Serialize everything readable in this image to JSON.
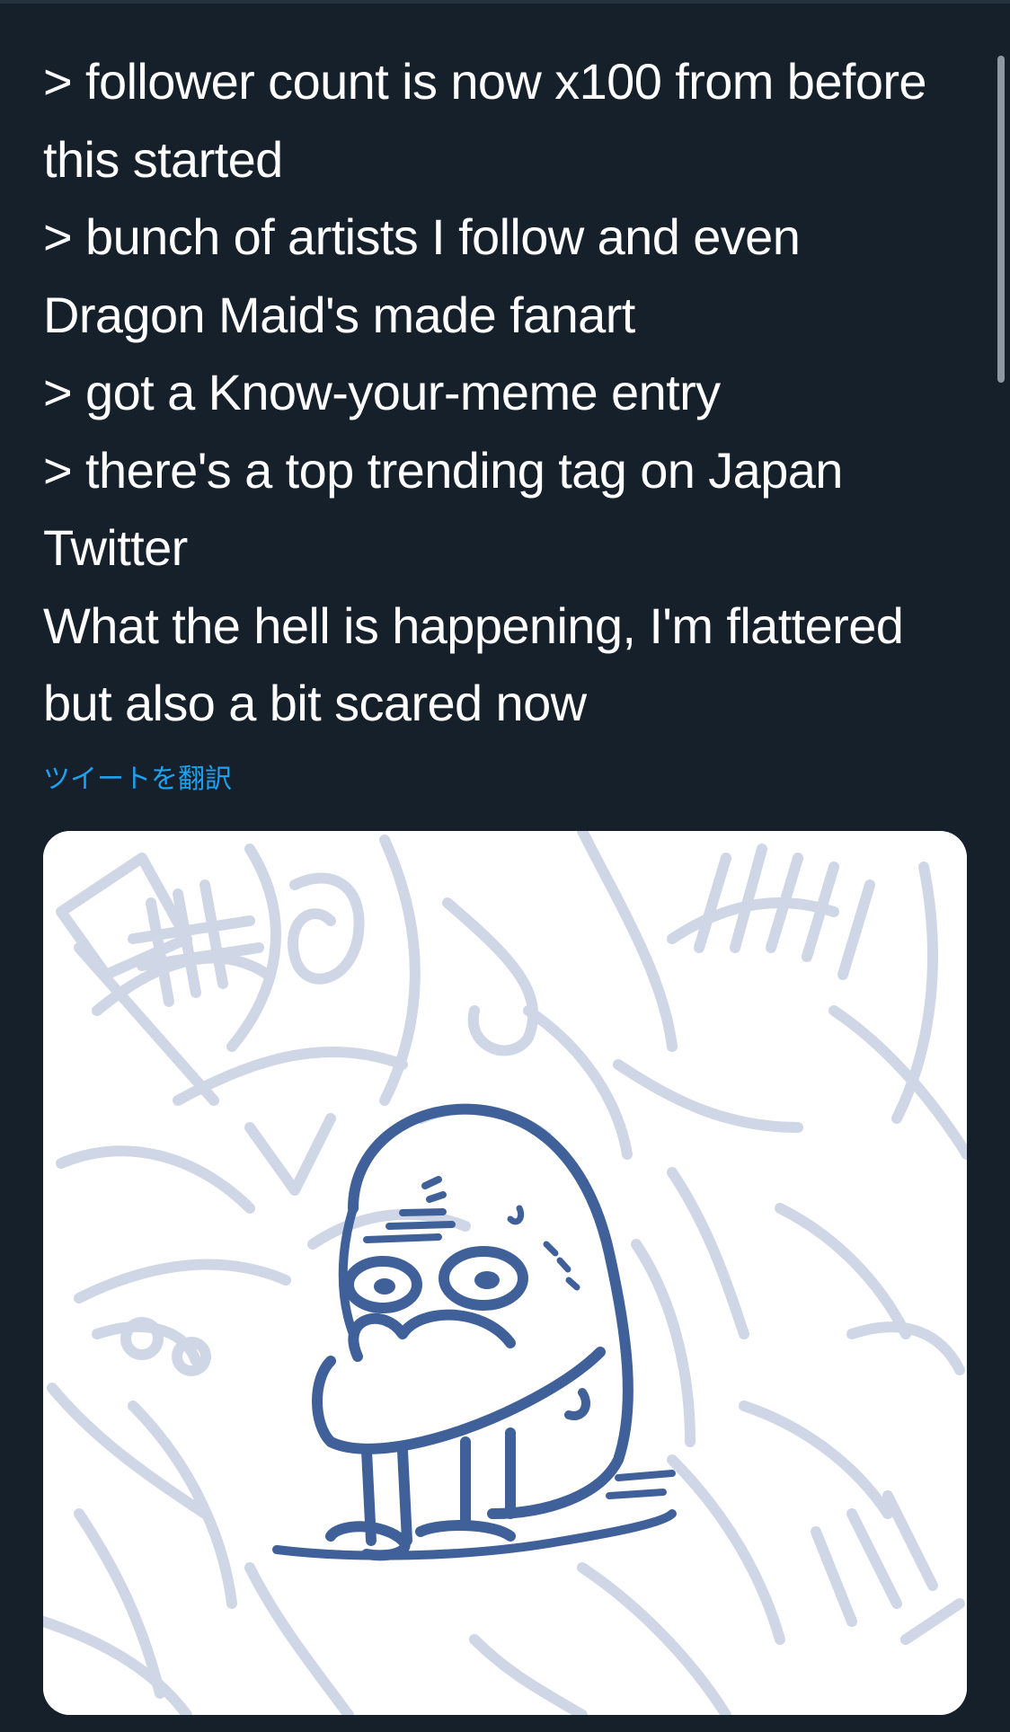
{
  "tweet": {
    "lines": [
      "> follower count is now x100 from before",
      "this started",
      "> bunch of artists I follow and even",
      "Dragon Maid's made fanart",
      "> got a Know-your-meme entry",
      "> there's a top trending tag on Japan",
      "Twitter",
      "What the hell is happening, I'm flattered",
      "but also a bit scared now"
    ],
    "translate_label": "ツイートを翻訳"
  },
  "media": {
    "sketch_color": "#cfd6e6",
    "figure_color": "#40609a"
  },
  "theme": {
    "background": "#15202b",
    "text": "#ffffff",
    "link": "#1da1f2"
  }
}
